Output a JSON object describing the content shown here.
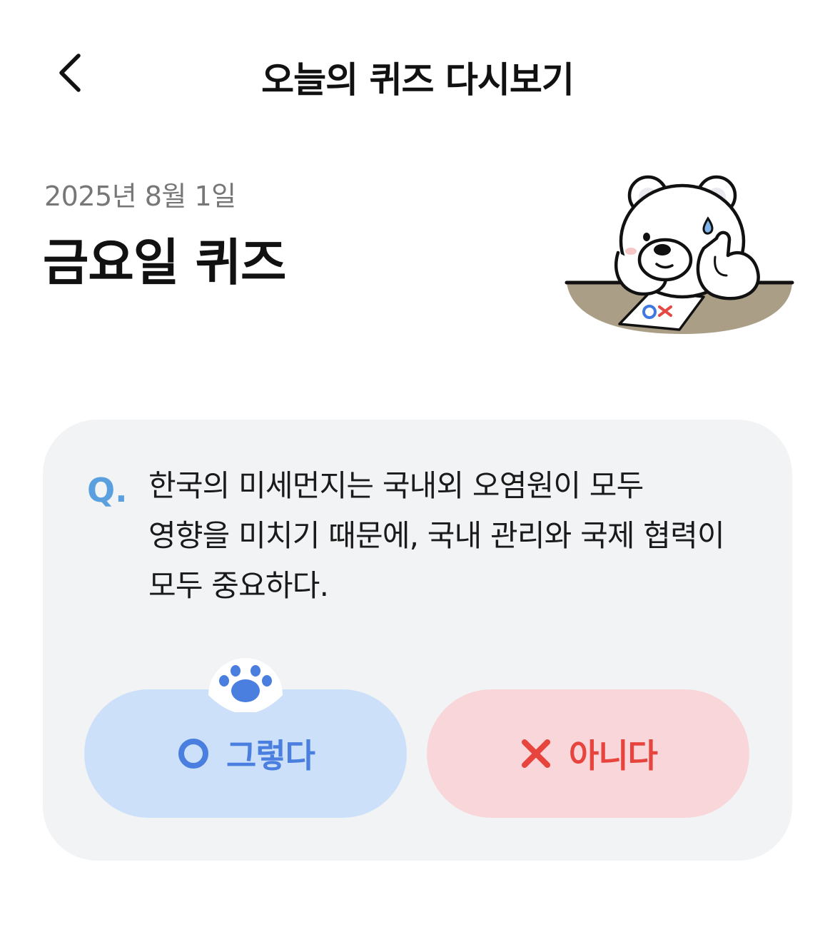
{
  "header": {
    "title": "오늘의 퀴즈 다시보기",
    "back_icon": "chevron-left-icon"
  },
  "quiz": {
    "date": "2025년 8월 1일",
    "title": "금요일 퀴즈",
    "mascot": "polar-bear-ox-quiz-illustration"
  },
  "card": {
    "q_label": "Q.",
    "question_lines": [
      "한국의 미세먼지는 국내외 오염원이 모두",
      "영향을 미치기 때문에, 국내 관리와 국제 협력이",
      "모두 중요하다."
    ],
    "answers": {
      "yes": {
        "label": "그렇다",
        "icon": "circle-o-icon",
        "color": "#4a7fe0",
        "bg": "#cde0fa"
      },
      "no": {
        "label": "아니다",
        "icon": "x-mark-icon",
        "color": "#e8443e",
        "bg": "#f8d6d9"
      }
    },
    "badge_icon": "paw-icon",
    "colors": {
      "card_bg": "#f2f3f5",
      "q_color": "#5aa0de"
    }
  }
}
